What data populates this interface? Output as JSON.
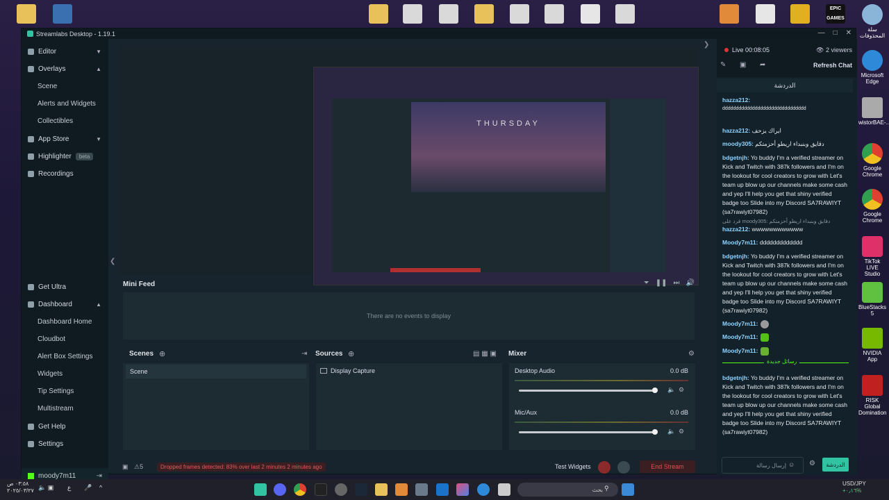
{
  "window": {
    "title": "Streamlabs Desktop - 1.19.1"
  },
  "nav": {
    "editor": "Editor",
    "overlays": "Overlays",
    "scene": "Scene",
    "alerts_widgets": "Alerts and Widgets",
    "collectibles": "Collectibles",
    "app_store": "App Store",
    "highlighter": "Highlighter",
    "highlighter_badge": "beta",
    "recordings": "Recordings",
    "get_ultra": "Get Ultra",
    "dashboard": "Dashboard",
    "dashboard_home": "Dashboard Home",
    "cloudbot": "Cloudbot",
    "alert_box": "Alert Box Settings",
    "widgets": "Widgets",
    "tip_settings": "Tip Settings",
    "multistream": "Multistream",
    "get_help": "Get Help",
    "settings": "Settings",
    "user": "moody7m11"
  },
  "preview": {
    "thursday_text": "THURSDAY"
  },
  "minifeed": {
    "title": "Mini Feed",
    "empty": "There are no events to display"
  },
  "scenes": {
    "title": "Scenes",
    "items": [
      "Scene"
    ]
  },
  "sources": {
    "title": "Sources",
    "items": [
      "Display Capture"
    ]
  },
  "mixer": {
    "title": "Mixer",
    "channels": [
      {
        "name": "Desktop Audio",
        "db": "0.0 dB",
        "level": 0.98
      },
      {
        "name": "Mic/Aux",
        "db": "0.0 dB",
        "level": 0.98
      }
    ]
  },
  "status": {
    "count": "5",
    "dropped": "Dropped frames detected: 83% over last 2 minutes 2 minutes ago",
    "test_widgets": "Test Widgets",
    "end_stream": "End Stream"
  },
  "chat": {
    "live": "Live 00:08:05",
    "viewers": "2 viewers",
    "refresh": "Refresh Chat",
    "header": "الدردشة",
    "new_messages": "رسائل جديدة",
    "input_placeholder": "إرسال رسالة",
    "send": "الدردشة",
    "messages": [
      {
        "user": "hazza212:",
        "text": ""
      },
      {
        "user": "",
        "text": "ddddddddddddddddddddddddddddddd"
      },
      {
        "user": "hazza212:",
        "text": "ايراك يزحف"
      },
      {
        "user": "moody305:",
        "text": "دقايق وبنبداء اريطو أحزمتكم"
      },
      {
        "user": "bdgetnjh:",
        "text": "Yo buddy I'm a verified streamer on Kick and Twitch with 387k followers and I'm on the lookout for cool creators to grow with  Let's team up blow up our channels make some cash  and yep  I'll help you get that shiny verified badge too Slide into my Discord SA7RAWIYT (sa7rawiyt07982)"
      },
      {
        "user": "",
        "text": "قرد على moody305: دقايق وبنبداء اريطو أحزمتكم"
      },
      {
        "user": "hazza212:",
        "text": "wwwwwwwwwwww"
      },
      {
        "user": "Moody7m11:",
        "text": "ddddddddddddd"
      },
      {
        "user": "bdgetnjh:",
        "text": "Yo buddy I'm a verified streamer on Kick and Twitch with 387k followers and I'm on the lookout for cool creators to grow with  Let's team up blow up our channels make some cash  and yep  I'll help you get that shiny verified badge too Slide into my Discord SA7RAWIYT (sa7rawiyt07982)"
      },
      {
        "user": "Moody7m11:",
        "text": ""
      },
      {
        "user": "Moody7m11:",
        "text": ""
      },
      {
        "user": "Moody7m11:",
        "text": ""
      },
      {
        "user": "bdgetnjh:",
        "text": "Yo buddy I'm a verified streamer on Kick and Twitch with 387k followers and I'm on the lookout for cool creators to grow with  Let's team up blow up our channels make some cash  and yep  I'll help you get that shiny verified badge too Slide into my Discord SA7RAWIYT (sa7rawiyt07982)"
      }
    ]
  },
  "desktop": {
    "icons_right": [
      "سلة المحذوفات",
      "Microsoft Edge",
      "wistorBAE-...",
      "Google Chrome",
      "Google Chrome",
      "TikTok LIVE Studio",
      "BlueStacks 5",
      "NVIDIA App",
      "RISK Global Domination"
    ],
    "epic_label": "EPIC GAMES"
  },
  "taskbar": {
    "search": "بحث",
    "clock_time": "٠٣:٥٨ ص",
    "clock_date": "٢٠٢٥/٠٣/٢٧",
    "lang": "ع",
    "usd": "USD/JPY",
    "usd_change": "+٠٫١٦%"
  }
}
